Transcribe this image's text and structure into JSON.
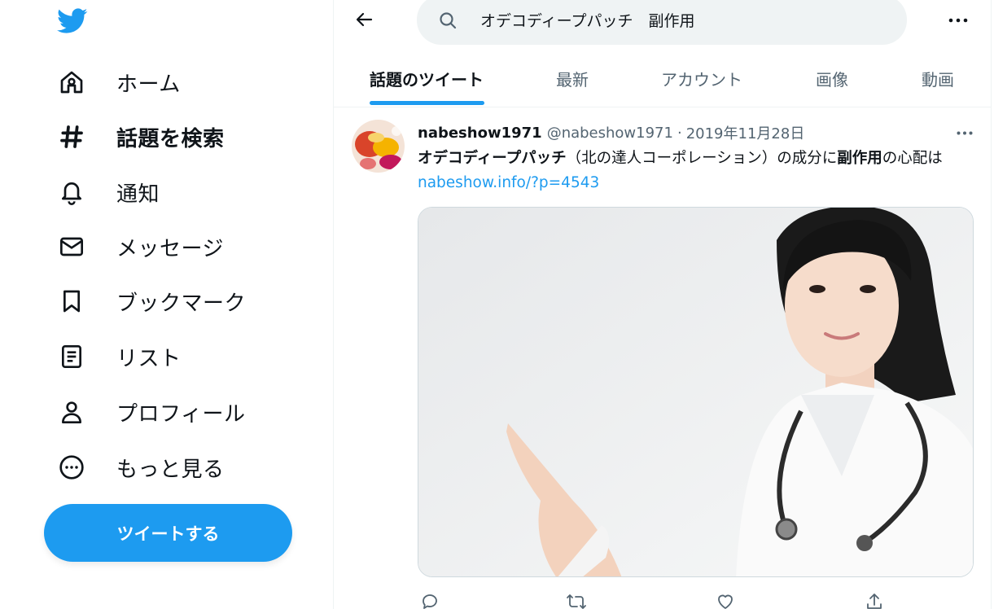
{
  "app": {
    "brand_color": "#1d9bf0"
  },
  "sidebar": {
    "items": [
      {
        "label": "ホーム",
        "icon": "home-icon"
      },
      {
        "label": "話題を検索",
        "icon": "hashtag-icon",
        "active": true
      },
      {
        "label": "通知",
        "icon": "bell-icon"
      },
      {
        "label": "メッセージ",
        "icon": "envelope-icon"
      },
      {
        "label": "ブックマーク",
        "icon": "bookmark-icon"
      },
      {
        "label": "リスト",
        "icon": "list-icon"
      },
      {
        "label": "プロフィール",
        "icon": "person-icon"
      },
      {
        "label": "もっと見る",
        "icon": "more-circle-icon"
      }
    ],
    "tweet_button": "ツイートする"
  },
  "search": {
    "value": "オデコディープパッチ　副作用"
  },
  "tabs": [
    {
      "label": "話題のツイート",
      "active": true
    },
    {
      "label": "最新"
    },
    {
      "label": "アカウント"
    },
    {
      "label": "画像"
    },
    {
      "label": "動画"
    }
  ],
  "tweet": {
    "author_name": "nabeshow1971",
    "author_handle": "@nabeshow1971",
    "separator": "·",
    "date": "2019年11月28日",
    "text_part1": "オデコディープパッチ",
    "text_part2": "（北の達人コーポレーション）の成分に",
    "text_part3": "副作用",
    "text_part4": "の心配は ",
    "link": "nabeshow.info/?p=4543"
  }
}
